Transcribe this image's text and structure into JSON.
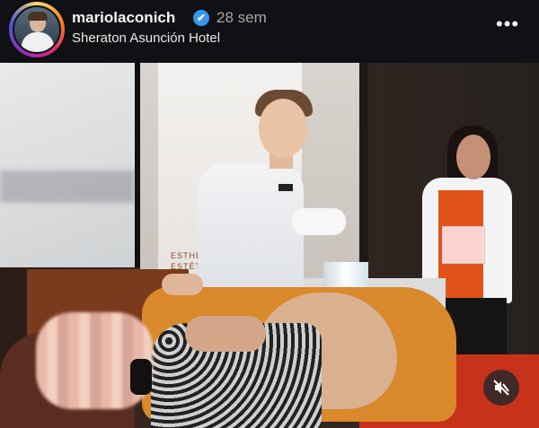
{
  "post": {
    "username": "mariolaconich",
    "verified_mark": "✔",
    "time": "28 sem",
    "location": "Sheraton Asunción Hotel",
    "more_label": "•••"
  },
  "photo": {
    "banner_line1": "ESTHE",
    "banner_line2": "ESTÉTICA"
  },
  "icons": {
    "avatar": "avatar-image",
    "verified": "verified-badge-icon",
    "more": "more-options-icon",
    "mute": "speaker-muted-icon"
  },
  "colors": {
    "verified_blue": "#3897f0",
    "header_bg": "#101114"
  }
}
